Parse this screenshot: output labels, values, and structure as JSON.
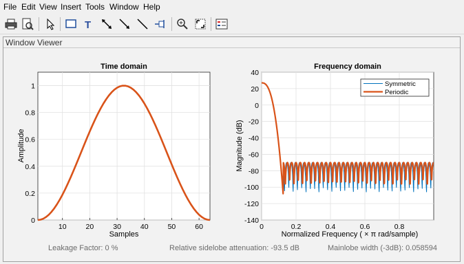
{
  "menu": [
    "File",
    "Edit",
    "View",
    "Insert",
    "Tools",
    "Window",
    "Help"
  ],
  "toolbar": {
    "buttons": [
      "print-icon",
      "print-preview-icon",
      "edit-plot-arrow-icon",
      "insert-rectangle-icon",
      "insert-text-icon",
      "insert-double-arrow-icon",
      "insert-arrow-icon",
      "insert-line-icon",
      "pin-icon",
      "zoom-in-icon",
      "fit-to-window-icon",
      "legend-icon"
    ]
  },
  "panel": {
    "title": "Window Viewer"
  },
  "chart_data": [
    {
      "type": "line",
      "title": "Time domain",
      "xlabel": "Samples",
      "ylabel": "Amplitude",
      "xlim": [
        1,
        64
      ],
      "ylim": [
        0,
        1.1
      ],
      "xticks": [
        10,
        20,
        30,
        40,
        50,
        60
      ],
      "xtick_labels": [
        "10",
        "20",
        "30",
        "40",
        "50",
        "60"
      ],
      "yticks": [
        0,
        0.2,
        0.4,
        0.6,
        0.8,
        1
      ],
      "ytick_labels": [
        "0",
        "0.2",
        "0.4",
        "0.6",
        "0.8",
        "1"
      ],
      "grid": true,
      "series": [
        {
          "color": "#d95319",
          "window": "hann",
          "length": 64
        }
      ]
    },
    {
      "type": "line",
      "title": "Frequency domain",
      "xlabel": "Normalized  Frequency    ( × π  rad/sample)",
      "ylabel": "Magnitude (dB)",
      "xlim": [
        0,
        1
      ],
      "ylim": [
        -140,
        40
      ],
      "xticks": [
        0,
        0.2,
        0.4,
        0.6,
        0.8
      ],
      "xtick_labels": [
        "0",
        "0.2",
        "0.4",
        "0.6",
        "0.8"
      ],
      "yticks": [
        40,
        20,
        0,
        -20,
        -40,
        -60,
        -80,
        -100,
        -120,
        -140
      ],
      "ytick_labels": [
        "40",
        "20",
        "0",
        "-20",
        "-40",
        "-60",
        "-80",
        "-100",
        "-120",
        "-140"
      ],
      "grid": true,
      "legend_position": "top-right",
      "series": [
        {
          "name": "Symmetric",
          "color": "#0072bd"
        },
        {
          "name": "Periodic",
          "color": "#d95319"
        }
      ],
      "peak_db": 27,
      "mainlobe_null": 0.125,
      "sidelobe_level_db": -68
    }
  ],
  "status": {
    "leakage": "Leakage Factor: 0 %",
    "attenuation": "Relative sidelobe attenuation: -93.5 dB",
    "mainlobe": "Mainlobe width (-3dB): 0.058594"
  }
}
